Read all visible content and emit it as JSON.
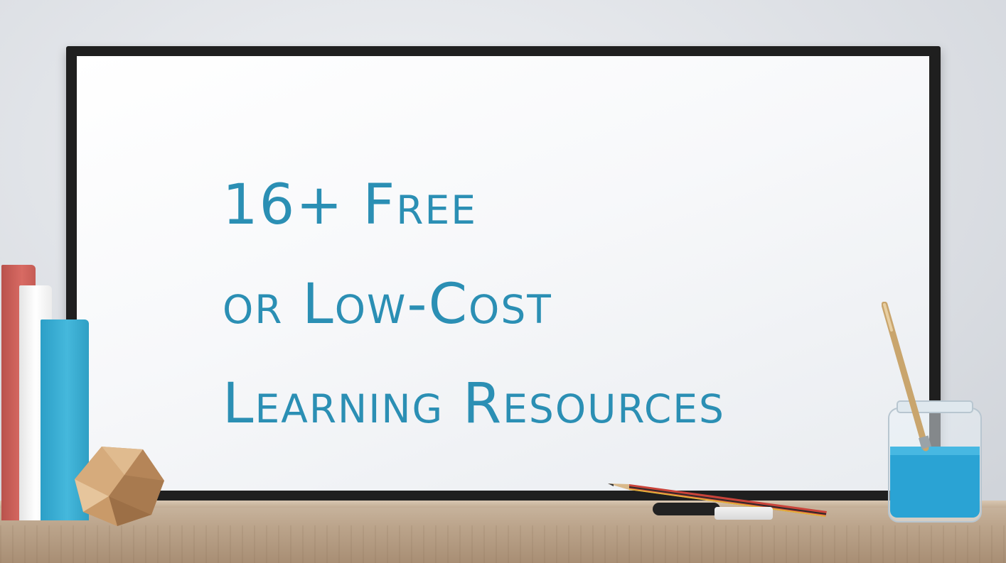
{
  "headline": {
    "line1": "16+ Free",
    "line2": "or Low-Cost",
    "line3": "Learning Resources"
  },
  "colors": {
    "text_accent": "#2b8fb4",
    "board_frame": "#1f1f1f",
    "book_red": "#d86a63",
    "book_blue": "#45b8dc",
    "jar_liquid": "#2aa3d4"
  },
  "icons": [
    "books-stack-icon",
    "wooden-polyhedron-icon",
    "pencil-icon",
    "marker-icon",
    "eraser-icon",
    "paint-jar-with-brush-icon"
  ]
}
